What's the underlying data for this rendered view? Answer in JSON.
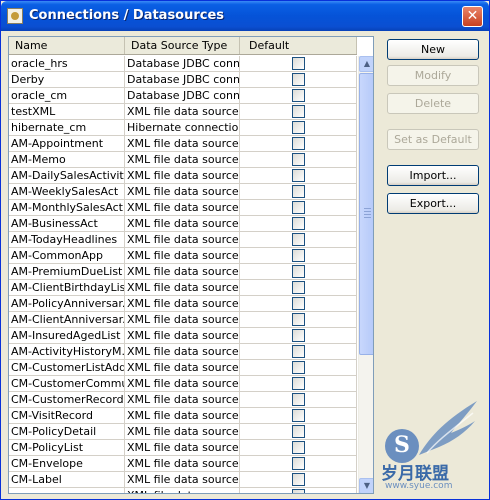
{
  "window": {
    "title": "Connections / Datasources",
    "close_glyph": "✕"
  },
  "table": {
    "columns": [
      "Name",
      "Data Source Type",
      "Default"
    ],
    "rows": [
      {
        "name": "oracle_hrs",
        "type": "Database JDBC conn...",
        "default": false
      },
      {
        "name": "Derby",
        "type": "Database JDBC conn...",
        "default": false
      },
      {
        "name": "oracle_cm",
        "type": "Database JDBC conn...",
        "default": false
      },
      {
        "name": "testXML",
        "type": "XML file data source",
        "default": false
      },
      {
        "name": "hibernate_cm",
        "type": "Hibernate connection",
        "default": false
      },
      {
        "name": "AM-Appointment",
        "type": "XML file data source",
        "default": false
      },
      {
        "name": "AM-Memo",
        "type": "XML file data source",
        "default": false
      },
      {
        "name": "AM-DailySalesActivity",
        "type": "XML file data source",
        "default": false
      },
      {
        "name": "AM-WeeklySalesAct",
        "type": "XML file data source",
        "default": false
      },
      {
        "name": "AM-MonthlySalesAct",
        "type": "XML file data source",
        "default": false
      },
      {
        "name": "AM-BusinessAct",
        "type": "XML file data source",
        "default": false
      },
      {
        "name": "AM-TodayHeadlines",
        "type": "XML file data source",
        "default": false
      },
      {
        "name": "AM-CommonApp",
        "type": "XML file data source",
        "default": false
      },
      {
        "name": "AM-PremiumDueList",
        "type": "XML file data source",
        "default": false
      },
      {
        "name": "AM-ClientBirthdayList",
        "type": "XML file data source",
        "default": false
      },
      {
        "name": "AM-PolicyAnniversar...",
        "type": "XML file data source",
        "default": false
      },
      {
        "name": "AM-ClientAnniversar...",
        "type": "XML file data source",
        "default": false
      },
      {
        "name": "AM-InsuredAgedList",
        "type": "XML file data source",
        "default": false
      },
      {
        "name": "AM-ActivityHistoryM...",
        "type": "XML file data source",
        "default": false
      },
      {
        "name": "CM-CustomerListAddr",
        "type": "XML file data source",
        "default": false
      },
      {
        "name": "CM-CustomerCommu...",
        "type": "XML file data source",
        "default": false
      },
      {
        "name": "CM-CustomerRecord",
        "type": "XML file data source",
        "default": false
      },
      {
        "name": "CM-VisitRecord",
        "type": "XML file data source",
        "default": false
      },
      {
        "name": "CM-PolicyDetail",
        "type": "XML file data source",
        "default": false
      },
      {
        "name": "CM-PolicyList",
        "type": "XML file data source",
        "default": false
      },
      {
        "name": "CM-Envelope",
        "type": "XML file data source",
        "default": false
      },
      {
        "name": "CM-Label",
        "type": "XML file data source",
        "default": false
      },
      {
        "name": "",
        "type": "XML file data source",
        "default": false
      }
    ]
  },
  "scrollbar": {
    "up_glyph": "▲",
    "down_glyph": "▼"
  },
  "buttons": {
    "new": "New",
    "modify": "Modify",
    "delete": "Delete",
    "set_default": "Set as Default",
    "import": "Import...",
    "export": "Export..."
  },
  "watermark": {
    "letter": "S",
    "brand": "岁月联盟",
    "site": "www.syue.com"
  },
  "icons": {
    "app": "datasource-app-icon",
    "close": "close-icon",
    "checkbox": "checkbox-icon",
    "scroll_up": "scroll-up-icon",
    "scroll_down": "scroll-down-icon"
  }
}
